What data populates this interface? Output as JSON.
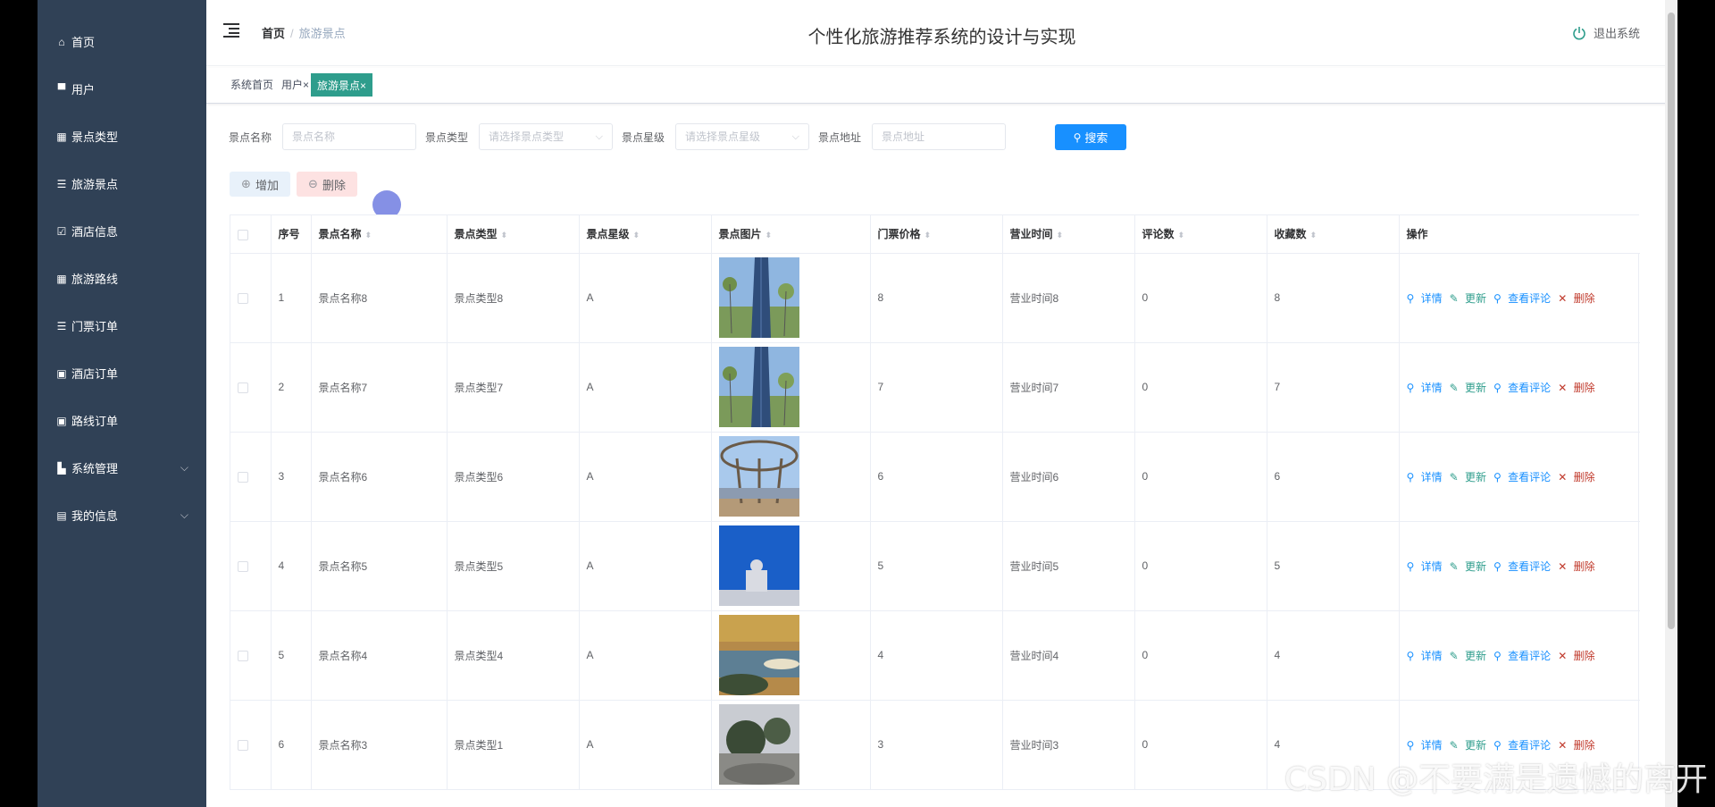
{
  "app": {
    "title": "个性化旅游推荐系统的设计与实现",
    "logout_label": "退出系统"
  },
  "breadcrumb": {
    "home": "首页",
    "current": "旅游景点"
  },
  "sidebar": {
    "items": [
      {
        "label": "首页",
        "icon": "home-icon",
        "glyph": "⌂"
      },
      {
        "label": "用户",
        "icon": "monitor-icon",
        "glyph": "▀"
      },
      {
        "label": "景点类型",
        "icon": "grid-icon",
        "glyph": "▦"
      },
      {
        "label": "旅游景点",
        "icon": "list-icon",
        "glyph": "☰"
      },
      {
        "label": "酒店信息",
        "icon": "checkbox-icon",
        "glyph": "☑"
      },
      {
        "label": "旅游路线",
        "icon": "grid-icon",
        "glyph": "▦"
      },
      {
        "label": "门票订单",
        "icon": "list-icon",
        "glyph": "☰"
      },
      {
        "label": "酒店订单",
        "icon": "clipboard-icon",
        "glyph": "▣"
      },
      {
        "label": "路线订单",
        "icon": "clipboard-icon",
        "glyph": "▣"
      },
      {
        "label": "系统管理",
        "icon": "chart-icon",
        "glyph": "▙"
      },
      {
        "label": "我的信息",
        "icon": "window-icon",
        "glyph": "▤"
      }
    ]
  },
  "tags": [
    {
      "label": "系统首页"
    },
    {
      "label": "用户",
      "close": "×"
    },
    {
      "label": "旅游景点",
      "close": "×",
      "active": true
    }
  ],
  "search": {
    "name_label": "景点名称",
    "name_placeholder": "景点名称",
    "type_label": "景点类型",
    "type_placeholder": "请选择景点类型",
    "level_label": "景点星级",
    "level_placeholder": "请选择景点星级",
    "address_label": "景点地址",
    "address_placeholder": "景点地址",
    "button_label": "搜索"
  },
  "actions": {
    "add_label": "增加",
    "delete_label": "删除"
  },
  "table": {
    "columns": {
      "index": "序号",
      "name": "景点名称",
      "type": "景点类型",
      "level": "景点星级",
      "image": "景点图片",
      "price": "门票价格",
      "hours": "营业时间",
      "comments": "评论数",
      "favorites": "收藏数",
      "ops": "操作"
    },
    "op_labels": {
      "detail": "详情",
      "update": "更新",
      "review": "查看评论",
      "delete": "删除"
    },
    "rows": [
      {
        "index": "1",
        "name": "景点名称8",
        "type": "景点类型8",
        "level": "A",
        "image": "tower",
        "price": "8",
        "hours": "营业时间8",
        "comments": "0",
        "favorites": "8"
      },
      {
        "index": "2",
        "name": "景点名称7",
        "type": "景点类型7",
        "level": "A",
        "image": "tower",
        "price": "7",
        "hours": "营业时间7",
        "comments": "0",
        "favorites": "7"
      },
      {
        "index": "3",
        "name": "景点名称6",
        "type": "景点类型6",
        "level": "A",
        "image": "canopy",
        "price": "6",
        "hours": "营业时间6",
        "comments": "0",
        "favorites": "6"
      },
      {
        "index": "4",
        "name": "景点名称5",
        "type": "景点类型5",
        "level": "A",
        "image": "moon",
        "price": "5",
        "hours": "营业时间5",
        "comments": "0",
        "favorites": "5"
      },
      {
        "index": "5",
        "name": "景点名称4",
        "type": "景点类型4",
        "level": "A",
        "image": "lake",
        "price": "4",
        "hours": "营业时间4",
        "comments": "0",
        "favorites": "4"
      },
      {
        "index": "6",
        "name": "景点名称3",
        "type": "景点类型1",
        "level": "A",
        "image": "rocks",
        "price": "3",
        "hours": "营业时间3",
        "comments": "0",
        "favorites": "4"
      }
    ]
  },
  "watermark": "CSDN @不要满是遗憾的离开",
  "colors": {
    "sidebar_bg": "#304156",
    "primary": "#1890ff",
    "tag_active": "#2e9d8c",
    "danger": "#c0392b"
  }
}
